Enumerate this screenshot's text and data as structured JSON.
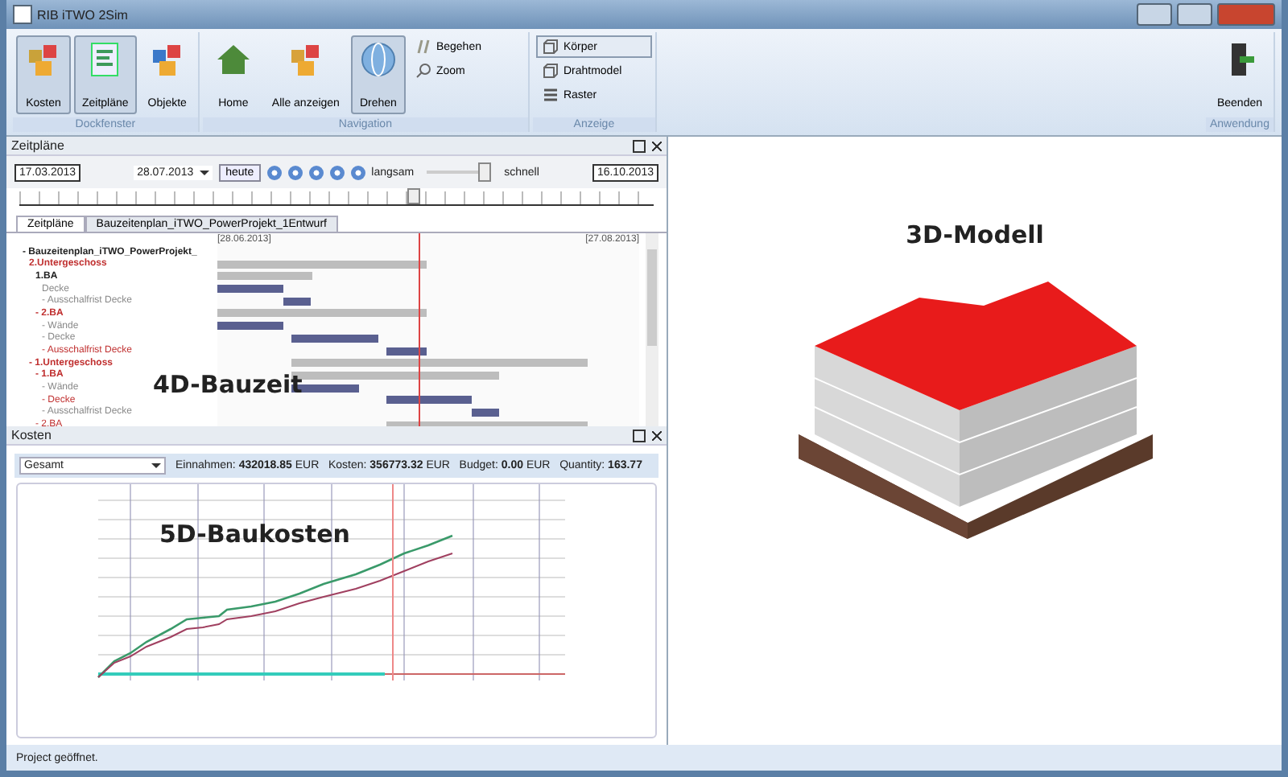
{
  "window": {
    "title": "RIB iTWO 2Sim"
  },
  "ribbon": {
    "groups": [
      {
        "label": "Dockfenster",
        "buttons": [
          {
            "label": "Kosten",
            "selected": true
          },
          {
            "label": "Zeitpläne",
            "selected": true
          },
          {
            "label": "Objekte",
            "selected": false
          }
        ]
      },
      {
        "label": "Navigation",
        "buttons": [
          {
            "label": "Home",
            "selected": false
          },
          {
            "label": "Alle anzeigen",
            "selected": false
          },
          {
            "label": "Drehen",
            "selected": true
          }
        ],
        "small": [
          {
            "label": "Begehen",
            "selected": false
          },
          {
            "label": "Zoom",
            "selected": false
          }
        ]
      },
      {
        "label": "Anzeige",
        "small": [
          {
            "label": "Körper",
            "selected": true
          },
          {
            "label": "Drahtmodel",
            "selected": false
          },
          {
            "label": "Raster",
            "selected": false
          }
        ]
      },
      {
        "label": "Anwendung",
        "buttons": [
          {
            "label": "Beenden",
            "selected": false
          }
        ]
      }
    ]
  },
  "schedule_panel": {
    "title": "Zeitpläne",
    "start_date": "17.03.2013",
    "current_date": "28.07.2013",
    "today_button": "heute",
    "slow_label": "langsam",
    "fast_label": "schnell",
    "speed": {
      "level": 1
    },
    "end_date": "16.10.2013",
    "timeline": {
      "level": 0.62
    },
    "tabs": [
      {
        "label": "Zeitpläne",
        "selected": true
      },
      {
        "label": "Bauzeitenplan_iTWO_PowerProjekt_1Entwurf",
        "selected": false
      }
    ],
    "date_left": "[28.06.2013]",
    "date_right": "[27.08.2013]",
    "tree": [
      {
        "label": "- Bauzeitenplan_iTWO_PowerProjekt_",
        "critical": false,
        "children": [
          {
            "label": "2.Untergeschoss",
            "critical": true,
            "children": [
              {
                "label": "1.BA",
                "critical": false,
                "children": [
                  {
                    "label": "Decke",
                    "critical": false
                  },
                  {
                    "label": "- Ausschalfrist Decke",
                    "critical": false
                  }
                ]
              },
              {
                "label": "- 2.BA",
                "critical": true,
                "children": [
                  {
                    "label": "- Wände",
                    "critical": false
                  },
                  {
                    "label": "- Decke",
                    "critical": false
                  },
                  {
                    "label": "- Ausschalfrist Decke",
                    "critical": true
                  }
                ]
              }
            ]
          },
          {
            "label": "- 1.Untergeschoss",
            "critical": true,
            "children": [
              {
                "label": "- 1.BA",
                "critical": true,
                "children": [
                  {
                    "label": "- Wände",
                    "critical": false
                  },
                  {
                    "label": "- Decke",
                    "critical": true
                  },
                  {
                    "label": "- Ausschalfrist Decke",
                    "critical": false
                  }
                ]
              },
              {
                "label": "- 2.BA",
                "critical": true
              }
            ]
          }
        ]
      }
    ],
    "caption": "4D-Bauzeit"
  },
  "cost_panel": {
    "title": "Kosten",
    "filter": "Gesamt",
    "summary": "Einnahmen: **432018.85** EUR   Kosten: **356773.32** EUR   Budget: **0.00** EUR   Quantity: **163.77**",
    "caption": "5D-Baukosten"
  },
  "model_view": {
    "caption": "3D-Modell"
  },
  "status_bar": {
    "text": "Project geöffnet."
  }
}
